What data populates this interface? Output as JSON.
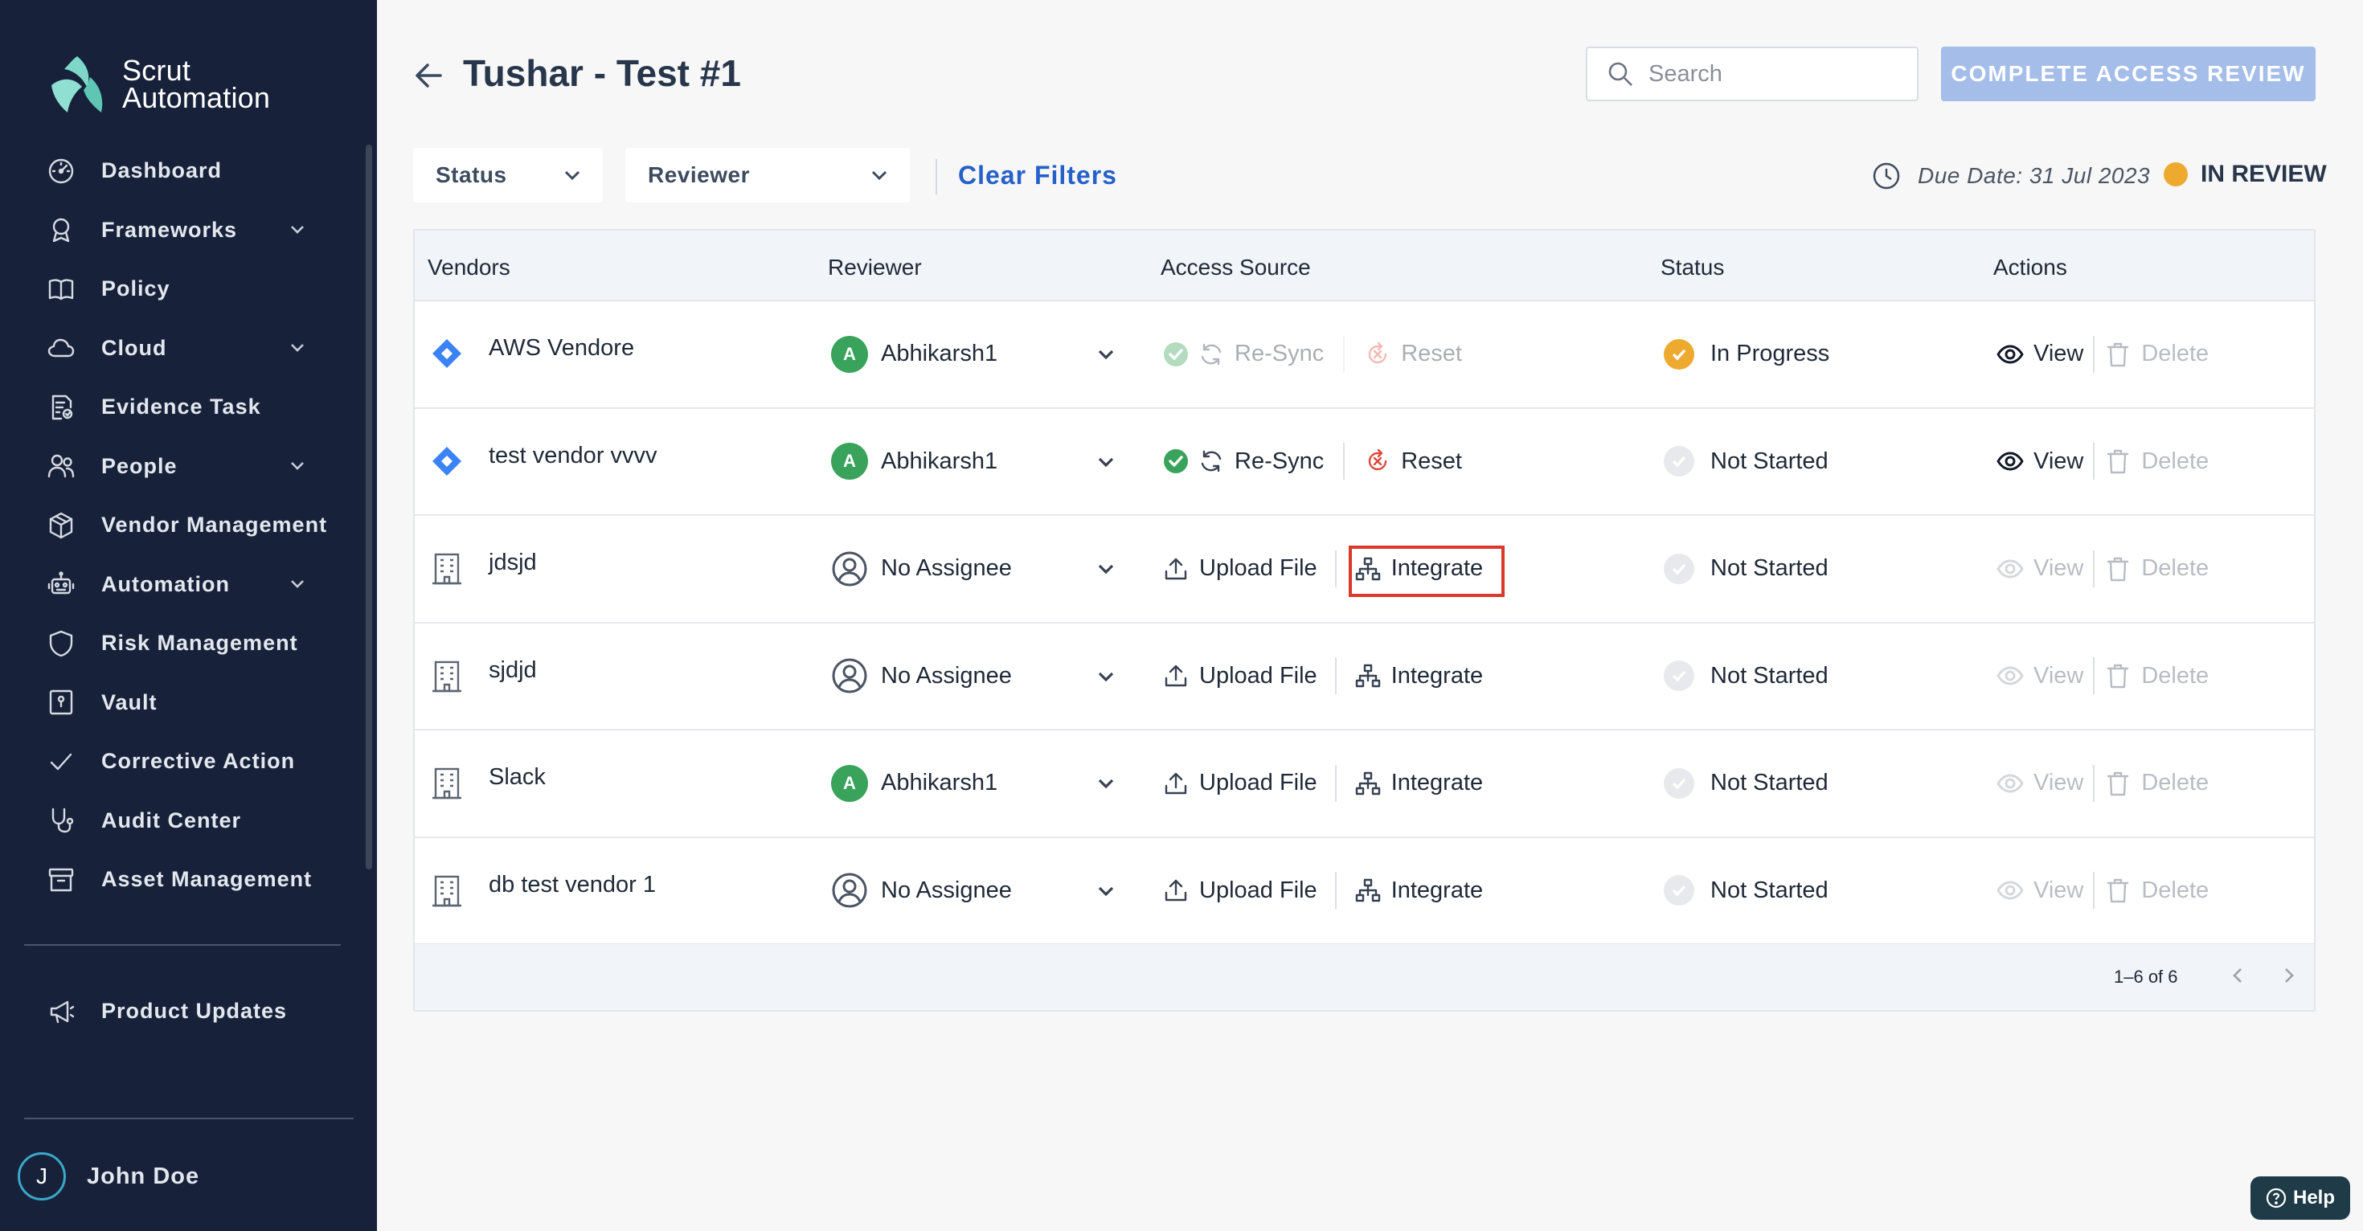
{
  "sidebar": {
    "logo_line1": "Scrut",
    "logo_line2": "Automation",
    "items": [
      {
        "label": "Dashboard",
        "icon": "dashboard-icon",
        "has_chevron": false
      },
      {
        "label": "Frameworks",
        "icon": "frameworks-icon",
        "has_chevron": true
      },
      {
        "label": "Policy",
        "icon": "policy-icon",
        "has_chevron": false
      },
      {
        "label": "Cloud",
        "icon": "cloud-icon",
        "has_chevron": true
      },
      {
        "label": "Evidence Task",
        "icon": "evidence-task-icon",
        "has_chevron": false
      },
      {
        "label": "People",
        "icon": "people-icon",
        "has_chevron": true
      },
      {
        "label": "Vendor Management",
        "icon": "vendor-management-icon",
        "has_chevron": false
      },
      {
        "label": "Automation",
        "icon": "automation-icon",
        "has_chevron": true
      },
      {
        "label": "Risk Management",
        "icon": "risk-management-icon",
        "has_chevron": false
      },
      {
        "label": "Vault",
        "icon": "vault-icon",
        "has_chevron": false
      },
      {
        "label": "Corrective Action",
        "icon": "check-icon",
        "has_chevron": false
      },
      {
        "label": "Audit Center",
        "icon": "audit-center-icon",
        "has_chevron": false
      },
      {
        "label": "Asset Management",
        "icon": "asset-management-icon",
        "has_chevron": false
      }
    ],
    "product_updates": "Product Updates",
    "user": {
      "initial": "J",
      "name": "John Doe"
    }
  },
  "header": {
    "title": "Tushar - Test #1",
    "search_placeholder": "Search",
    "complete_button": "COMPLETE ACCESS REVIEW"
  },
  "filters": {
    "status": "Status",
    "reviewer": "Reviewer",
    "clear": "Clear Filters",
    "due_date": "Due Date: 31 Jul 2023",
    "review_status": "IN REVIEW"
  },
  "table": {
    "columns": [
      "Vendors",
      "Reviewer",
      "Access Source",
      "Status",
      "Actions"
    ],
    "rows": [
      {
        "vendor": "AWS Vendore",
        "vendor_icon": "diamond",
        "reviewer": "Abhikarsh1",
        "reviewer_initial": "A",
        "assigned": true,
        "source": "resync",
        "source_active": false,
        "status": "In Progress",
        "status_kind": "progress",
        "actions_enabled": true
      },
      {
        "vendor": "test vendor vvvv",
        "vendor_icon": "diamond",
        "reviewer": "Abhikarsh1",
        "reviewer_initial": "A",
        "assigned": true,
        "source": "resync",
        "source_active": true,
        "status": "Not Started",
        "status_kind": "none",
        "actions_enabled": true
      },
      {
        "vendor": "jdsjd",
        "vendor_icon": "building",
        "reviewer": "No Assignee",
        "reviewer_initial": "",
        "assigned": false,
        "source": "upload",
        "source_active": true,
        "status": "Not Started",
        "status_kind": "none",
        "actions_enabled": false,
        "highlight_integrate": true
      },
      {
        "vendor": "sjdjd",
        "vendor_icon": "building",
        "reviewer": "No Assignee",
        "reviewer_initial": "",
        "assigned": false,
        "source": "upload",
        "source_active": true,
        "status": "Not Started",
        "status_kind": "none",
        "actions_enabled": false
      },
      {
        "vendor": "Slack",
        "vendor_icon": "building",
        "reviewer": "Abhikarsh1",
        "reviewer_initial": "A",
        "assigned": true,
        "source": "upload",
        "source_active": true,
        "status": "Not Started",
        "status_kind": "none",
        "actions_enabled": false
      },
      {
        "vendor": "db test vendor 1",
        "vendor_icon": "building",
        "reviewer": "No Assignee",
        "reviewer_initial": "",
        "assigned": false,
        "source": "upload",
        "source_active": true,
        "status": "Not Started",
        "status_kind": "none",
        "actions_enabled": false
      }
    ],
    "labels": {
      "resync": "Re-Sync",
      "reset": "Reset",
      "upload": "Upload File",
      "integrate": "Integrate",
      "view": "View",
      "delete": "Delete"
    },
    "pagination": "1–6 of 6"
  },
  "help_label": "Help",
  "colors": {
    "sidebar_bg": "#17223a",
    "accent_blue": "#2561c8",
    "button_disabled": "#a5bde9",
    "in_review_dot": "#eeaa2f",
    "assignee_green": "#3aa35b",
    "success_green": "#3aa35b",
    "reset_red": "#e0463a",
    "highlight_red": "#d93a2b"
  }
}
